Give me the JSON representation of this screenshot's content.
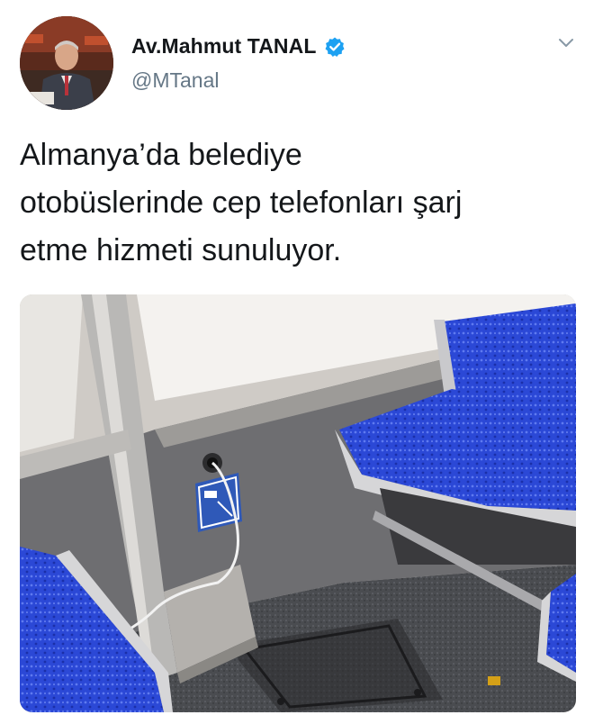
{
  "tweet": {
    "author": {
      "display_name": "Av.Mahmut TANAL",
      "handle": "@MTanal",
      "verified": true,
      "avatar_icon": "profile-photo"
    },
    "text": "Almanya’da belediye\notobüslerinde cep telefonları şarj\netme hizmeti sunuluyor.",
    "menu_icon": "chevron-down-icon",
    "media": {
      "type": "photo",
      "description_icon": "bus-seat-usb-charger"
    }
  },
  "colors": {
    "verified_blue": "#1da1f2",
    "handle_gray": "#657786",
    "seat_blue": "#2b48d6"
  }
}
